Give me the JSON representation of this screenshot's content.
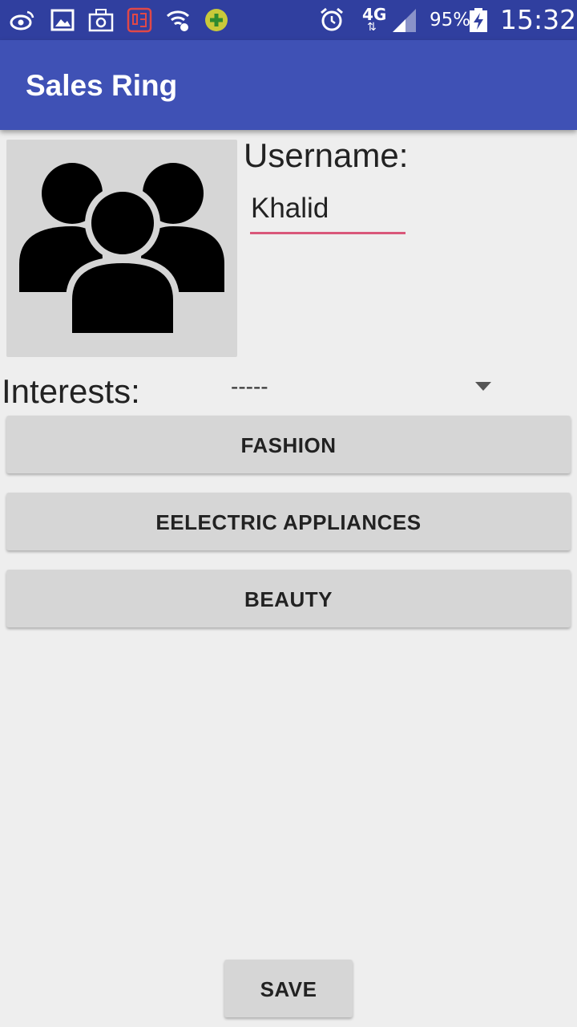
{
  "status_bar": {
    "network": "4G",
    "battery": "95%",
    "time": "15:32",
    "icons": [
      "weibo-icon",
      "gallery-icon",
      "camera-app-icon",
      "music-app-icon",
      "wifi-icon",
      "plus-app-icon",
      "alarm-icon",
      "signal-icon",
      "battery-charging-icon"
    ]
  },
  "app_bar": {
    "title": "Sales Ring"
  },
  "profile": {
    "avatar_icon": "group-icon",
    "username_label": "Username:",
    "username_value": "Khalid"
  },
  "interests": {
    "label": "Interests:",
    "selected": "-----"
  },
  "buttons": {
    "fashion": "FASHION",
    "electric": "EELECTRIC APPLIANCES",
    "beauty": "BEAUTY",
    "save": "SAVE"
  },
  "colors": {
    "status_bar": "#303f9f",
    "app_bar": "#3f51b5",
    "input_underline": "#d9577a",
    "button": "#d6d6d6",
    "background": "#eeeeee"
  }
}
